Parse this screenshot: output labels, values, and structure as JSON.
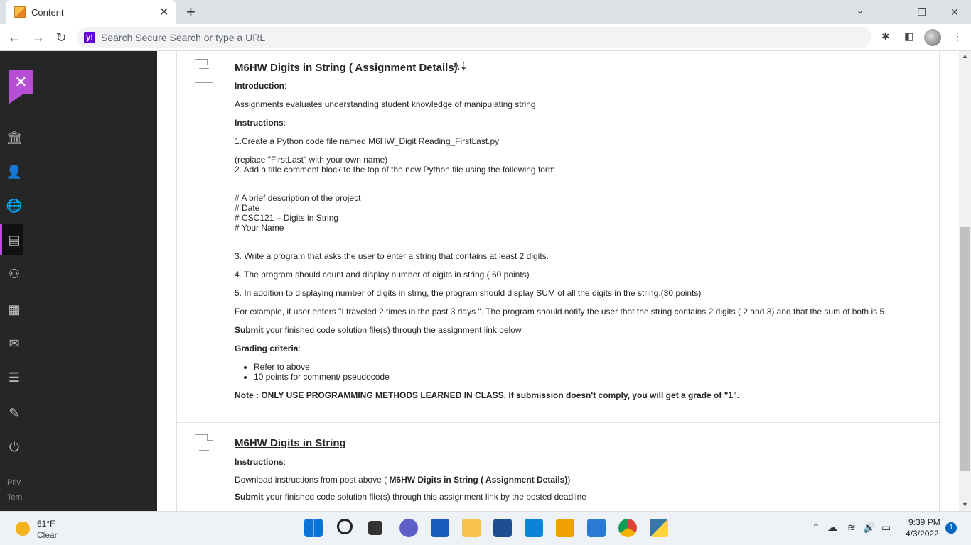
{
  "browser": {
    "tab_title": "Content",
    "tab_close": "✕",
    "new_tab": "+",
    "omnibox_placeholder": "Search Secure Search or type a URL",
    "omnibox_badge": "y!"
  },
  "sidebar": {
    "close_label": "✕",
    "footer_privacy": "Priv",
    "footer_terms": "Tern"
  },
  "item1": {
    "title": "M6HW Digits in String ( Assignment Details)",
    "intro_label": "Introduction",
    "intro_text": "Assignments evaluates understanding student knowledge of manipulating string",
    "instructions_label": "Instructions",
    "step1": "1.Create a Python code file named M6HW_Digit Reading_FirstLast.py",
    "step1_note": "(replace \"FirstLast\" with your own name)",
    "step2": "2. Add a title comment block to the top of the new Python file using the following form",
    "comment_lines": [
      "# A brief description of the project",
      "# Date",
      "# CSC121 – Digits in String",
      "# Your Name"
    ],
    "step3": "3. Write a program that asks the user to enter a string that contains at least 2 digits.",
    "step4": "4. The program should count and display number of digits in string  ( 60 points)",
    "step5": "5. In addition to displaying number of digits in strng, the program should display SUM of all the digits in the string.(30 points)",
    "example": "For example, if user enters \"I traveled 2 times in the past 3 days \". The program should notify the user that the string contains 2 digits ( 2 and 3) and that the sum of both is 5.",
    "submit_bold": "Submit",
    "submit_text": " your finished code solution file(s) through the assignment link below",
    "grading_label": "Grading criteria",
    "grading_items": [
      "Refer to above",
      "10 points for comment/ pseudocode"
    ],
    "note": "Note : ONLY USE PROGRAMMING METHODS LEARNED IN CLASS.  If submission doesn't comply, you will get a grade of \"1\"."
  },
  "item2": {
    "title": "M6HW Digits in String",
    "instructions_label": "Instructions",
    "download_prefix": "Download instructions from post above ( ",
    "download_bold": "M6HW Digits in String ( Assignment Details)",
    "download_suffix": ")",
    "submit_bold": "Submit",
    "submit_text": " your finished code solution file(s) through this assignment link by the posted deadline"
  },
  "taskbar": {
    "temperature": "61°F",
    "condition": "Clear",
    "time": "9:39 PM",
    "date": "4/3/2022",
    "notification_count": "1"
  },
  "colors": {
    "accent_purple": "#b64fd6",
    "sidebar_dark": "#262626",
    "yahoo_purple": "#6001d2"
  }
}
